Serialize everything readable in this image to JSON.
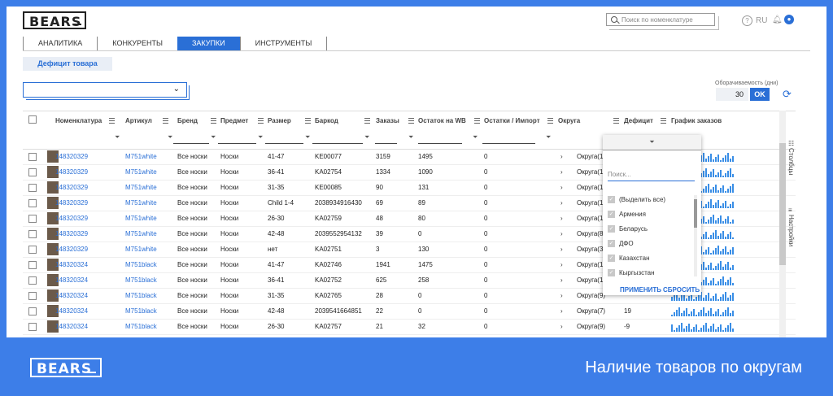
{
  "app": {
    "logo": "BEARS",
    "search_placeholder": "Поиск по номенклатуре",
    "lang": "RU"
  },
  "tabs": [
    "АНАЛИТИКА",
    "КОНКУРЕНТЫ",
    "ЗАКУПКИ",
    "ИНСТРУМЕНТЫ"
  ],
  "active_tab": "ЗАКУПКИ",
  "sub_button": "Дефицит товара",
  "turnover": {
    "label": "Оборачиваемость (дни)",
    "value": "30",
    "ok": "OK"
  },
  "columns": [
    "Номенклатура",
    "Артикул",
    "Бренд",
    "Предмет",
    "Размер",
    "Баркод",
    "Заказы",
    "Остаток на WB",
    "Остатки / Импорт",
    "Округа",
    "Дефицит",
    "График заказов"
  ],
  "rows": [
    {
      "nm": "148320329",
      "art": "M751white",
      "brand": "Все носки",
      "subj": "Носки",
      "size": "41-47",
      "bar": "KE00077",
      "orders": "3159",
      "stock": "1495",
      "imp": "0",
      "okr": "Округа(12)",
      "def": ""
    },
    {
      "nm": "148320329",
      "art": "M751white",
      "brand": "Все носки",
      "subj": "Носки",
      "size": "36-41",
      "bar": "KA02754",
      "orders": "1334",
      "stock": "1090",
      "imp": "0",
      "okr": "Округа(12)",
      "def": ""
    },
    {
      "nm": "148320329",
      "art": "M751white",
      "brand": "Все носки",
      "subj": "Носки",
      "size": "31-35",
      "bar": "KE00085",
      "orders": "90",
      "stock": "131",
      "imp": "0",
      "okr": "Округа(10)",
      "def": ""
    },
    {
      "nm": "148320329",
      "art": "M751white",
      "brand": "Все носки",
      "subj": "Носки",
      "size": "Child 1-4",
      "bar": "2038934916430",
      "orders": "69",
      "stock": "89",
      "imp": "0",
      "okr": "Округа(10)",
      "def": ""
    },
    {
      "nm": "148320329",
      "art": "M751white",
      "brand": "Все носки",
      "subj": "Носки",
      "size": "26-30",
      "bar": "KA02759",
      "orders": "48",
      "stock": "80",
      "imp": "0",
      "okr": "Округа(10)",
      "def": ""
    },
    {
      "nm": "148320329",
      "art": "M751white",
      "brand": "Все носки",
      "subj": "Носки",
      "size": "42-48",
      "bar": "2039552954132",
      "orders": "39",
      "stock": "0",
      "imp": "0",
      "okr": "Округа(8)",
      "def": ""
    },
    {
      "nm": "148320329",
      "art": "M751white",
      "brand": "Все носки",
      "subj": "Носки",
      "size": "нет",
      "bar": "KA02751",
      "orders": "3",
      "stock": "130",
      "imp": "0",
      "okr": "Округа(3)",
      "def": ""
    },
    {
      "nm": "148320324",
      "art": "M751black",
      "brand": "Все носки",
      "subj": "Носки",
      "size": "41-47",
      "bar": "KA02746",
      "orders": "1941",
      "stock": "1475",
      "imp": "0",
      "okr": "Округа(11)",
      "def": ""
    },
    {
      "nm": "148320324",
      "art": "M751black",
      "brand": "Все носки",
      "subj": "Носки",
      "size": "36-41",
      "bar": "KA02752",
      "orders": "625",
      "stock": "258",
      "imp": "0",
      "okr": "Округа(11)",
      "def": ""
    },
    {
      "nm": "148320324",
      "art": "M751black",
      "brand": "Все носки",
      "subj": "Носки",
      "size": "31-35",
      "bar": "KA02765",
      "orders": "28",
      "stock": "0",
      "imp": "0",
      "okr": "Округа(9)",
      "def": ""
    },
    {
      "nm": "148320324",
      "art": "M751black",
      "brand": "Все носки",
      "subj": "Носки",
      "size": "42-48",
      "bar": "2039541664851",
      "orders": "22",
      "stock": "0",
      "imp": "0",
      "okr": "Округа(7)",
      "def": "19"
    },
    {
      "nm": "148320324",
      "art": "M751black",
      "brand": "Все носки",
      "subj": "Носки",
      "size": "26-30",
      "bar": "KA02757",
      "orders": "21",
      "stock": "32",
      "imp": "0",
      "okr": "Округа(9)",
      "def": "-9"
    }
  ],
  "filter_popup": {
    "search": "Поиск...",
    "options": [
      "(Выделить все)",
      "Армения",
      "Беларусь",
      "ДФО",
      "Казахстан",
      "Кыргызстан"
    ],
    "apply": "ПРИМЕНИТЬ",
    "reset": "СБРОСИТЬ"
  },
  "side": {
    "columns": "Столбцы",
    "settings": "Настройки"
  },
  "footer": {
    "logo": "BEARS",
    "caption": "Наличие товаров по округам"
  }
}
